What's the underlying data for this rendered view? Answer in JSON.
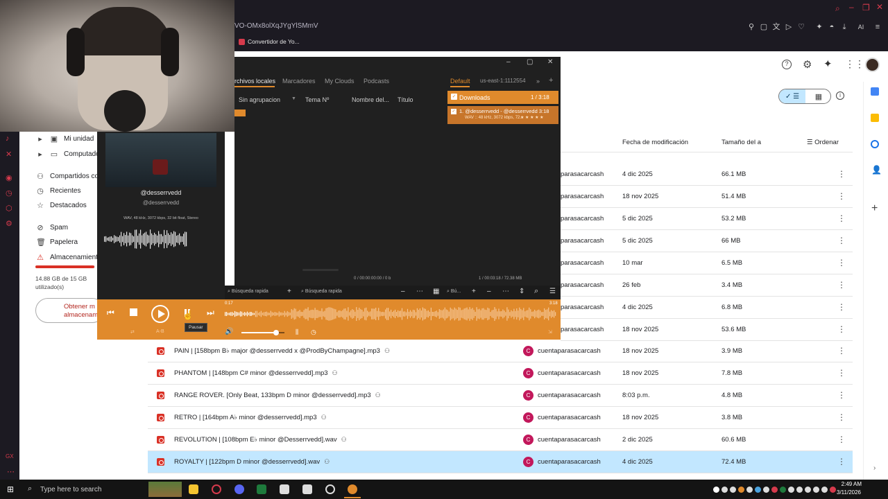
{
  "browser": {
    "address": "VO-OMx8olXqJYgYlSMmV",
    "bookmark": "Convertidor de Yo...",
    "toolbar_ai": "AI"
  },
  "drive": {
    "nav": [
      "Mi unidad",
      "Computadoras",
      "Compartidos co",
      "Recientes",
      "Destacados",
      "Spam",
      "Papelera",
      "Almacenamient"
    ],
    "storage_text": "14.88 GB de 15 GB utilizado(s)",
    "storage_percent": 99,
    "storage_button": "Obtener m almacenami",
    "col_date": "Fecha de modificación",
    "col_size": "Tamaño del a",
    "sort_label": "Ordenar",
    "partial_rows": [
      {
        "owner": "parasacarcash",
        "date": "4 dic 2025",
        "size": "66.1 MB"
      },
      {
        "owner": "parasacarcash",
        "date": "18 nov 2025",
        "size": "51.4 MB"
      },
      {
        "owner": "parasacarcash",
        "date": "5 dic 2025",
        "size": "53.2 MB"
      },
      {
        "owner": "parasacarcash",
        "date": "5 dic 2025",
        "size": "66 MB"
      },
      {
        "owner": "parasacarcash",
        "date": "10 mar",
        "size": "6.5 MB"
      },
      {
        "owner": "parasacarcash",
        "date": "26 feb",
        "size": "3.4 MB"
      },
      {
        "owner": "parasacarcash",
        "date": "4 dic 2025",
        "size": "6.8 MB"
      },
      {
        "owner": "parasacarcash",
        "date": "18 nov 2025",
        "size": "53.6 MB"
      }
    ],
    "rows": [
      {
        "name": "PAIN | [158bpm B♭ major @desserrvedd x @ProdByChampagne].mp3",
        "owner": "cuentaparasacarcash",
        "date": "18 nov 2025",
        "size": "3.9 MB"
      },
      {
        "name": "PHANTOM | [148bpm C# minor @desserrvedd].mp3",
        "owner": "cuentaparasacarcash",
        "date": "18 nov 2025",
        "size": "7.8 MB"
      },
      {
        "name": "RANGE ROVER. [Only Beat, 133bpm D minor @desserrvedd].mp3",
        "owner": "cuentaparasacarcash",
        "date": "8:03 p.m.",
        "size": "4.8 MB"
      },
      {
        "name": "RETRO | [164bpm A♭ minor @desserrvedd].mp3",
        "owner": "cuentaparasacarcash",
        "date": "18 nov 2025",
        "size": "3.8 MB"
      },
      {
        "name": "REVOLUTION | [108bpm E♭ minor @Desserrvedd].wav",
        "owner": "cuentaparasacarcash",
        "date": "2 dic 2025",
        "size": "60.6 MB"
      },
      {
        "name": "ROYALTY | [122bpm D minor @desserrvedd].wav",
        "owner": "cuentaparasacarcash",
        "date": "4 dic 2025",
        "size": "72.4 MB"
      }
    ],
    "avatar_letter": "C"
  },
  "player": {
    "tabs": [
      "rchivos locales",
      "Marcadores",
      "My Clouds",
      "Podcasts"
    ],
    "playlist_tabs": [
      "Default",
      "us-east-1:1112554"
    ],
    "group_label": "Sin agrupacion",
    "cols": [
      "Tema Nº",
      "Nombre del...",
      "Título"
    ],
    "playlist_title": "Downloads",
    "playlist_count": "1 / 3:18",
    "track_line1": "1. @desserrvedd - @desserrvedd  3:18",
    "track_line2": "WAV :: 48 kHz, 3072 kbps, 72...",
    "artist1": "@desserrvedd",
    "artist2": "@desserrvedd",
    "format": "WAV, 48 kHz, 3072 kbps, 32 bit float, Stereo",
    "status_left": "0 / 00:00:00:00 / 0 b",
    "status_right": "1 / 00:03:18 / 72.38 MB",
    "search1": "Búsqueda rapida",
    "search2": "Búsqueda rapida",
    "search3": "Bú...",
    "time_pos": "0:17",
    "time_total": "3:18",
    "tooltip": "Pausar",
    "ab_label": "A-B",
    "progress_fraction": 0.09,
    "volume_fraction": 0.8
  },
  "taskbar": {
    "search_placeholder": "Type here to search",
    "time": "2:49 AM",
    "date": "3/11/2026"
  },
  "colors": {
    "accent_orange": "#e08a2c",
    "drive_select": "#c2e7ff",
    "opera_red": "#d63a4c"
  }
}
